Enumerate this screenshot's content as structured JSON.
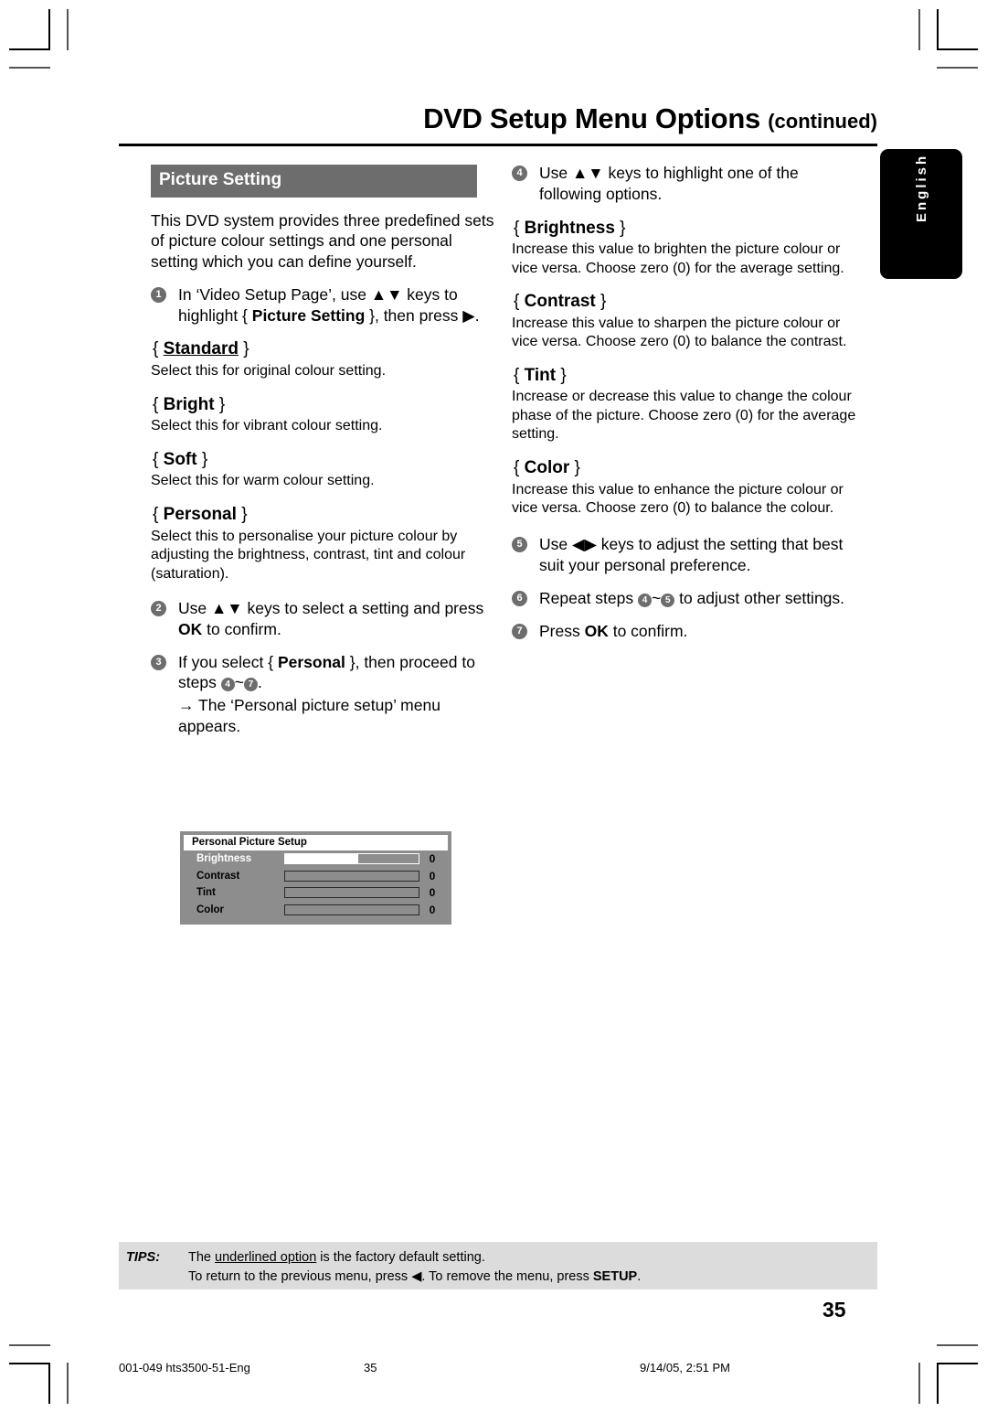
{
  "header": {
    "title": "DVD Setup Menu Options",
    "continued": "(continued)"
  },
  "language_tab": {
    "label": "English"
  },
  "left_column": {
    "section_title": "Picture Setting",
    "intro": "This DVD system provides three predefined sets of picture colour settings and one personal setting which you can define yourself.",
    "step1": {
      "number": "1",
      "text_before": "In ‘Video Setup Page’, use ▲▼ keys to highlight { ",
      "bold": "Picture Setting",
      "text_after": " }, then press ▶."
    },
    "options": [
      {
        "name": "Standard",
        "underlined": true,
        "open": "{",
        "close": "}",
        "desc": "Select this for original colour setting."
      },
      {
        "name": "Bright",
        "underlined": false,
        "open": "{",
        "close": "}",
        "desc": "Select this for vibrant colour setting."
      },
      {
        "name": "Soft",
        "underlined": false,
        "open": "{",
        "close": "}",
        "desc": "Select this for warm colour setting."
      },
      {
        "name": "Personal",
        "underlined": false,
        "open": "{",
        "close": "}",
        "desc": "Select this to personalise your picture colour by adjusting the brightness, contrast, tint and colour (saturation)."
      }
    ],
    "step2": {
      "number": "2",
      "text_before": "Use ▲▼ keys to select a setting and press ",
      "bold": "OK",
      "text_after": " to confirm."
    },
    "step3": {
      "number": "3",
      "text_before": "If you select { ",
      "bold": "Personal",
      "text_mid": " }, then proceed to steps ",
      "ref_from": "4",
      "ref_sep": "~",
      "ref_to": "7",
      "text_after": ".",
      "result_arrow": "→",
      "result": " The ‘Personal picture setup’ menu appears."
    }
  },
  "osd_menu": {
    "title": "Personal Picture Setup",
    "rows": [
      {
        "label": "Brightness",
        "value": "0",
        "fill_percent": 55,
        "selected": true
      },
      {
        "label": "Contrast",
        "value": "0",
        "fill_percent": 0,
        "selected": false
      },
      {
        "label": "Tint",
        "value": "0",
        "fill_percent": 0,
        "selected": false
      },
      {
        "label": "Color",
        "value": "0",
        "fill_percent": 0,
        "selected": false
      }
    ]
  },
  "right_column": {
    "step4": {
      "number": "4",
      "text": "Use ▲▼ keys to highlight one of the following options."
    },
    "options": [
      {
        "name": "Brightness",
        "open": "{",
        "close": "}",
        "desc": "Increase this value to brighten the picture colour or vice versa. Choose zero (0) for the average setting."
      },
      {
        "name": "Contrast",
        "open": "{",
        "close": "}",
        "desc": "Increase this value to sharpen the picture colour or vice versa.  Choose zero (0) to balance the contrast."
      },
      {
        "name": "Tint",
        "open": "{",
        "close": "}",
        "desc": "Increase or decrease this value to change the colour phase of the picture.  Choose zero (0) for the average setting."
      },
      {
        "name": "Color",
        "open": "{",
        "close": "}",
        "desc": "Increase this value to enhance the picture colour or vice versa. Choose zero (0) to balance the colour."
      }
    ],
    "step5": {
      "number": "5",
      "text": "Use ◀▶  keys to adjust the setting that best suit your personal preference."
    },
    "step6": {
      "number": "6",
      "text_before": "Repeat steps ",
      "ref_from": "4",
      "ref_sep": "~",
      "ref_to": "5",
      "text_after": " to adjust other settings."
    },
    "step7": {
      "number": "7",
      "text_before": "Press ",
      "bold": "OK",
      "text_after": " to confirm."
    }
  },
  "tips": {
    "label": "TIPS:",
    "line1_before": "The ",
    "line1_underlined": "underlined option",
    "line1_after": " is the factory default setting.",
    "line2_before": "To return to the previous menu, press ◀. To remove the menu, press ",
    "line2_bold": "SETUP",
    "line2_after": "."
  },
  "page_number": "35",
  "print_footer": {
    "file": "001-049 hts3500-51-Eng",
    "page": "35",
    "date": "9/14/05, 2:51 PM"
  }
}
